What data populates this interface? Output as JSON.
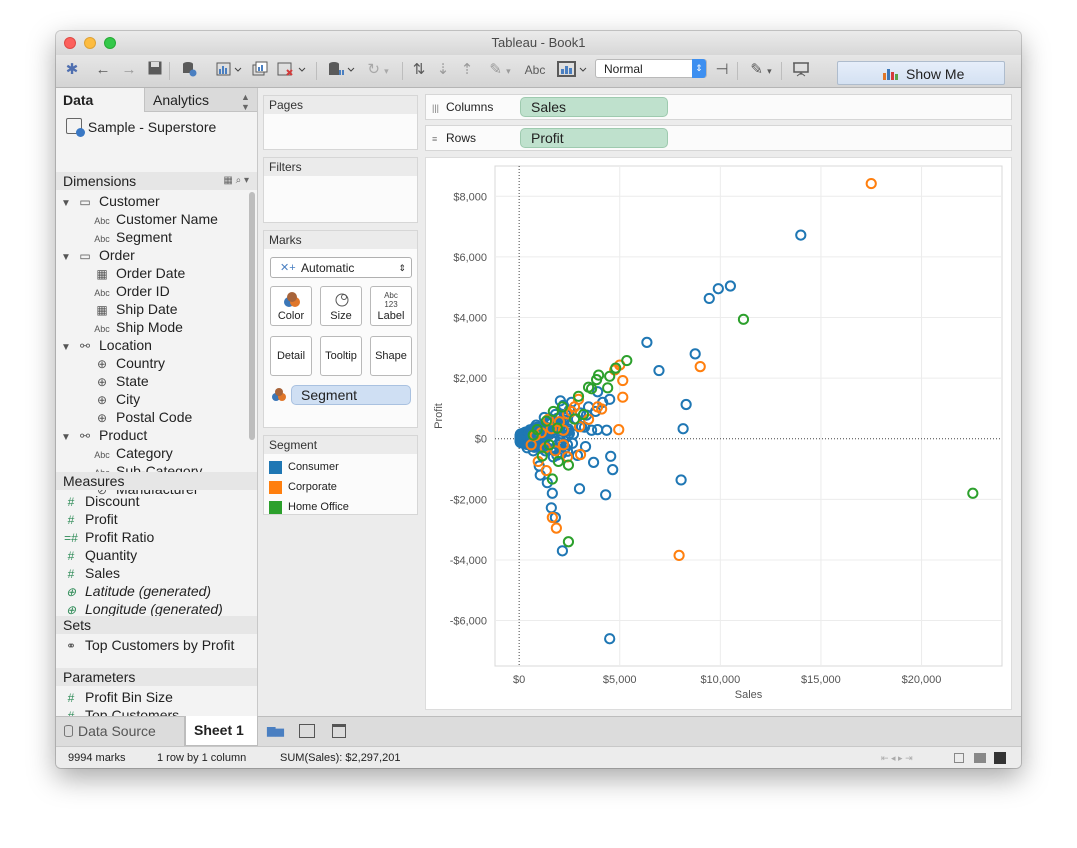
{
  "window": {
    "title": "Tableau - Book1"
  },
  "toolbar": {
    "view_select": "Normal",
    "abc": "Abc",
    "show_me": "Show Me"
  },
  "left_pane": {
    "tabs": [
      "Data",
      "Analytics"
    ],
    "data_source": "Sample - Superstore",
    "dimensions_header": "Dimensions",
    "dimensions": [
      {
        "label": "Customer",
        "kind": "folder"
      },
      {
        "label": "Customer Name",
        "kind": "abc"
      },
      {
        "label": "Segment",
        "kind": "abc"
      },
      {
        "label": "Order",
        "kind": "folder"
      },
      {
        "label": "Order Date",
        "kind": "date"
      },
      {
        "label": "Order ID",
        "kind": "abc"
      },
      {
        "label": "Ship Date",
        "kind": "date"
      },
      {
        "label": "Ship Mode",
        "kind": "abc"
      },
      {
        "label": "Location",
        "kind": "hierarchy"
      },
      {
        "label": "Country",
        "kind": "geo"
      },
      {
        "label": "State",
        "kind": "geo"
      },
      {
        "label": "City",
        "kind": "geo"
      },
      {
        "label": "Postal Code",
        "kind": "geo"
      },
      {
        "label": "Product",
        "kind": "hierarchy"
      },
      {
        "label": "Category",
        "kind": "abc"
      },
      {
        "label": "Sub-Category",
        "kind": "abc"
      },
      {
        "label": "Manufacturer",
        "kind": "clip"
      }
    ],
    "measures_header": "Measures",
    "measures": [
      "Discount",
      "Profit",
      "Profit Ratio",
      "Quantity",
      "Sales",
      "Latitude (generated)",
      "Longitude (generated)"
    ],
    "sets_header": "Sets",
    "sets": [
      "Top Customers by Profit"
    ],
    "parameters_header": "Parameters",
    "parameters": [
      "Profit Bin Size",
      "Top Customers"
    ]
  },
  "cards": {
    "pages": "Pages",
    "filters": "Filters",
    "marks": "Marks",
    "marks_type": "Automatic",
    "mark_buttons": [
      "Color",
      "Size",
      "Label",
      "Detail",
      "Tooltip",
      "Shape"
    ],
    "label_glyph": "Abc\n123",
    "color_field": "Segment"
  },
  "legend": {
    "title": "Segment",
    "items": [
      {
        "label": "Consumer",
        "color": "#1f77b4"
      },
      {
        "label": "Corporate",
        "color": "#ff7f0e"
      },
      {
        "label": "Home Office",
        "color": "#2ca02c"
      }
    ]
  },
  "shelves": {
    "columns_label": "Columns",
    "columns_pill": "Sales",
    "rows_label": "Rows",
    "rows_pill": "Profit"
  },
  "chart_data": {
    "type": "scatter",
    "xlabel": "Sales",
    "ylabel": "Profit",
    "xlim": [
      -1200,
      24000
    ],
    "ylim": [
      -7500,
      9000
    ],
    "x_ticks": [
      "$0",
      "$5,000",
      "$10,000",
      "$15,000",
      "$20,000"
    ],
    "y_ticks": [
      "$8,000",
      "$6,000",
      "$4,000",
      "$2,000",
      "$0",
      "-$2,000",
      "-$4,000",
      "-$6,000"
    ],
    "series": [
      {
        "name": "Consumer",
        "color": "#1f77b4",
        "points": [
          [
            13999,
            6720
          ],
          [
            10500,
            5040
          ],
          [
            9900,
            4950
          ],
          [
            9450,
            4630
          ],
          [
            6350,
            3180
          ],
          [
            6950,
            2250
          ],
          [
            8750,
            2800
          ],
          [
            8300,
            1130
          ],
          [
            8150,
            330
          ],
          [
            8050,
            -1360
          ],
          [
            4500,
            -6600
          ],
          [
            4550,
            -580
          ],
          [
            4650,
            -1020
          ],
          [
            4300,
            -1850
          ],
          [
            3000,
            -1650
          ],
          [
            2150,
            -3700
          ],
          [
            1800,
            -2600
          ],
          [
            1600,
            -2280
          ],
          [
            1050,
            -1200
          ],
          [
            1400,
            -1450
          ],
          [
            1000,
            -900
          ],
          [
            1650,
            -1800
          ],
          [
            3250,
            380
          ],
          [
            3600,
            280
          ],
          [
            3900,
            300
          ],
          [
            4350,
            280
          ],
          [
            4500,
            1300
          ],
          [
            4150,
            1200
          ],
          [
            3800,
            900
          ],
          [
            3900,
            1550
          ],
          [
            3450,
            1050
          ],
          [
            3050,
            850
          ],
          [
            2850,
            650
          ],
          [
            2600,
            1200
          ],
          [
            2500,
            950
          ],
          [
            2250,
            700
          ],
          [
            2100,
            520
          ],
          [
            1950,
            420
          ],
          [
            1750,
            300
          ],
          [
            1550,
            200
          ],
          [
            1350,
            120
          ],
          [
            1200,
            60
          ],
          [
            1050,
            -10
          ],
          [
            900,
            -80
          ],
          [
            800,
            30
          ],
          [
            700,
            -60
          ],
          [
            600,
            -20
          ],
          [
            500,
            0
          ],
          [
            400,
            50
          ],
          [
            300,
            -30
          ],
          [
            250,
            20
          ],
          [
            150,
            0
          ],
          [
            100,
            -20
          ],
          [
            1300,
            -400
          ],
          [
            1700,
            -600
          ],
          [
            2300,
            -300
          ],
          [
            2900,
            -550
          ],
          [
            2700,
            150
          ],
          [
            1450,
            520
          ],
          [
            1600,
            350
          ],
          [
            2000,
            260
          ],
          [
            2200,
            1100
          ],
          [
            1800,
            800
          ],
          [
            3100,
            400
          ],
          [
            3350,
            780
          ],
          [
            2650,
            -150
          ],
          [
            900,
            380
          ],
          [
            650,
            230
          ],
          [
            1100,
            240
          ],
          [
            400,
            -300
          ],
          [
            700,
            -400
          ],
          [
            350,
            200
          ],
          [
            3700,
            -780
          ],
          [
            3300,
            -260
          ],
          [
            1900,
            -200
          ],
          [
            1550,
            650
          ],
          [
            2450,
            320
          ],
          [
            1250,
            700
          ],
          [
            850,
            450
          ],
          [
            550,
            110
          ],
          [
            2050,
            1250
          ],
          [
            1150,
            -300
          ]
        ]
      },
      {
        "name": "Corporate",
        "color": "#ff7f0e",
        "points": [
          [
            17500,
            8420
          ],
          [
            9000,
            2380
          ],
          [
            7950,
            -3850
          ],
          [
            5150,
            1920
          ],
          [
            5150,
            1370
          ],
          [
            4750,
            2270
          ],
          [
            5000,
            2430
          ],
          [
            2950,
            1300
          ],
          [
            2750,
            1050
          ],
          [
            4950,
            300
          ],
          [
            3050,
            -520
          ],
          [
            1850,
            -2950
          ],
          [
            1650,
            -2600
          ],
          [
            950,
            -750
          ],
          [
            1350,
            -1050
          ],
          [
            2400,
            -600
          ],
          [
            2200,
            280
          ],
          [
            3000,
            400
          ],
          [
            1450,
            640
          ],
          [
            1600,
            330
          ],
          [
            2000,
            560
          ],
          [
            2400,
            820
          ],
          [
            2600,
            900
          ],
          [
            1100,
            200
          ],
          [
            800,
            100
          ],
          [
            600,
            -200
          ],
          [
            1300,
            -300
          ],
          [
            1800,
            -400
          ],
          [
            2200,
            -200
          ],
          [
            3450,
            640
          ],
          [
            3900,
            1050
          ],
          [
            4100,
            980
          ]
        ]
      },
      {
        "name": "Home Office",
        "color": "#2ca02c",
        "points": [
          [
            22550,
            -1800
          ],
          [
            11150,
            3940
          ],
          [
            5350,
            2580
          ],
          [
            4500,
            2060
          ],
          [
            4800,
            2330
          ],
          [
            3850,
            1950
          ],
          [
            3950,
            2100
          ],
          [
            3450,
            1700
          ],
          [
            2950,
            1400
          ],
          [
            4400,
            1680
          ],
          [
            2450,
            -3400
          ],
          [
            1650,
            -1330
          ],
          [
            2450,
            -870
          ],
          [
            1150,
            -570
          ],
          [
            1900,
            350
          ],
          [
            2150,
            1050
          ],
          [
            1350,
            580
          ],
          [
            2750,
            650
          ],
          [
            3200,
            800
          ],
          [
            900,
            300
          ],
          [
            1500,
            -200
          ],
          [
            1950,
            -750
          ],
          [
            700,
            120
          ],
          [
            3600,
            1650
          ],
          [
            1700,
            900
          ]
        ]
      }
    ]
  },
  "bottom": {
    "data_source_tab": "Data Source",
    "sheet_tab": "Sheet 1"
  },
  "status": {
    "marks": "9994 marks",
    "dims": "1 row by 1 column",
    "sum": "SUM(Sales): $2,297,201"
  }
}
